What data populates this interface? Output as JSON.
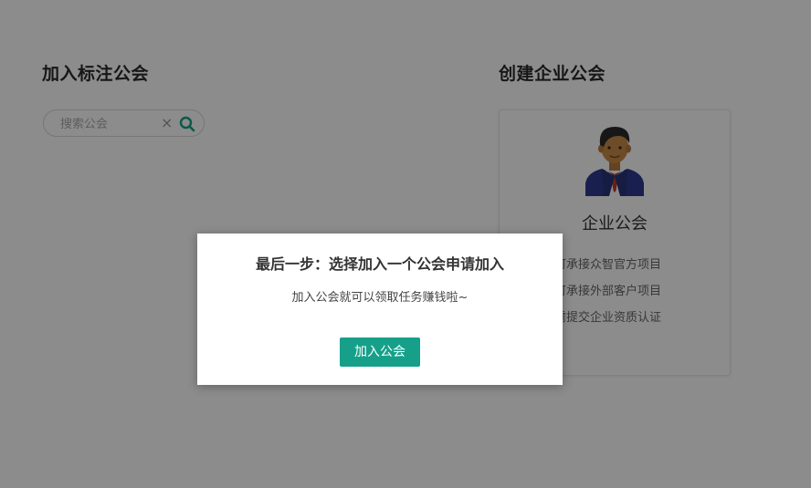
{
  "join_section": {
    "title": "加入标注公会",
    "search": {
      "placeholder": "搜索公会",
      "value": "",
      "clear_glyph": "×"
    }
  },
  "create_section": {
    "title": "创建企业公会",
    "card": {
      "avatar_icon": "businessman-avatar-icon",
      "title": "企业公会",
      "features": [
        "可承接众智官方项目",
        "可承接外部客户项目",
        "需提交企业资质认证"
      ]
    }
  },
  "modal": {
    "title": "最后一步：选择加入一个公会申请加入",
    "text": "加入公会就可以领取任务赚钱啦~",
    "button_label": "加入公会"
  },
  "colors": {
    "accent": "#16a08a",
    "overlay": "rgba(0,0,0,0.45)"
  }
}
